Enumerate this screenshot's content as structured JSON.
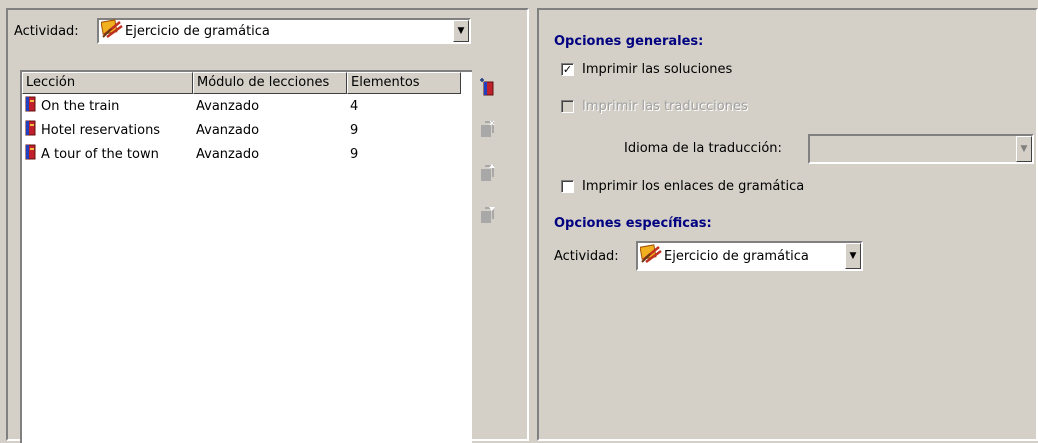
{
  "left_panel": {
    "activity_label": "Actividad:",
    "activity_value": "Ejercicio de gramática",
    "table": {
      "headers": [
        "Lección",
        "Módulo de lecciones",
        "Elementos"
      ],
      "rows": [
        {
          "leccion": "On the train",
          "modulo": "Avanzado",
          "elementos": "4"
        },
        {
          "leccion": "Hotel reservations",
          "modulo": "Avanzado",
          "elementos": "9"
        },
        {
          "leccion": "A tour of the town",
          "modulo": "Avanzado",
          "elementos": "9"
        }
      ]
    },
    "toolbar_icons": [
      "add-lesson-icon",
      "remove-lesson-icon",
      "move-up-icon",
      "move-down-icon"
    ]
  },
  "right_panel": {
    "general_heading": "Opciones generales:",
    "print_solutions": {
      "label": "Imprimir las soluciones",
      "checked": true,
      "enabled": true
    },
    "print_translations": {
      "label": "Imprimir las traducciones",
      "checked": false,
      "enabled": false
    },
    "translation_language_label": "Idioma de la traducción:",
    "translation_language_value": "",
    "print_grammar_links": {
      "label": "Imprimir los enlaces de gramática",
      "checked": false,
      "enabled": true
    },
    "specific_heading": "Opciones específicas:",
    "activity_label": "Actividad:",
    "activity_value": "Ejercicio de gramática"
  },
  "colors": {
    "heading": "#000080",
    "face": "#d4d0c8",
    "book_red": "#c0202a",
    "book_blue": "#2040c0"
  }
}
